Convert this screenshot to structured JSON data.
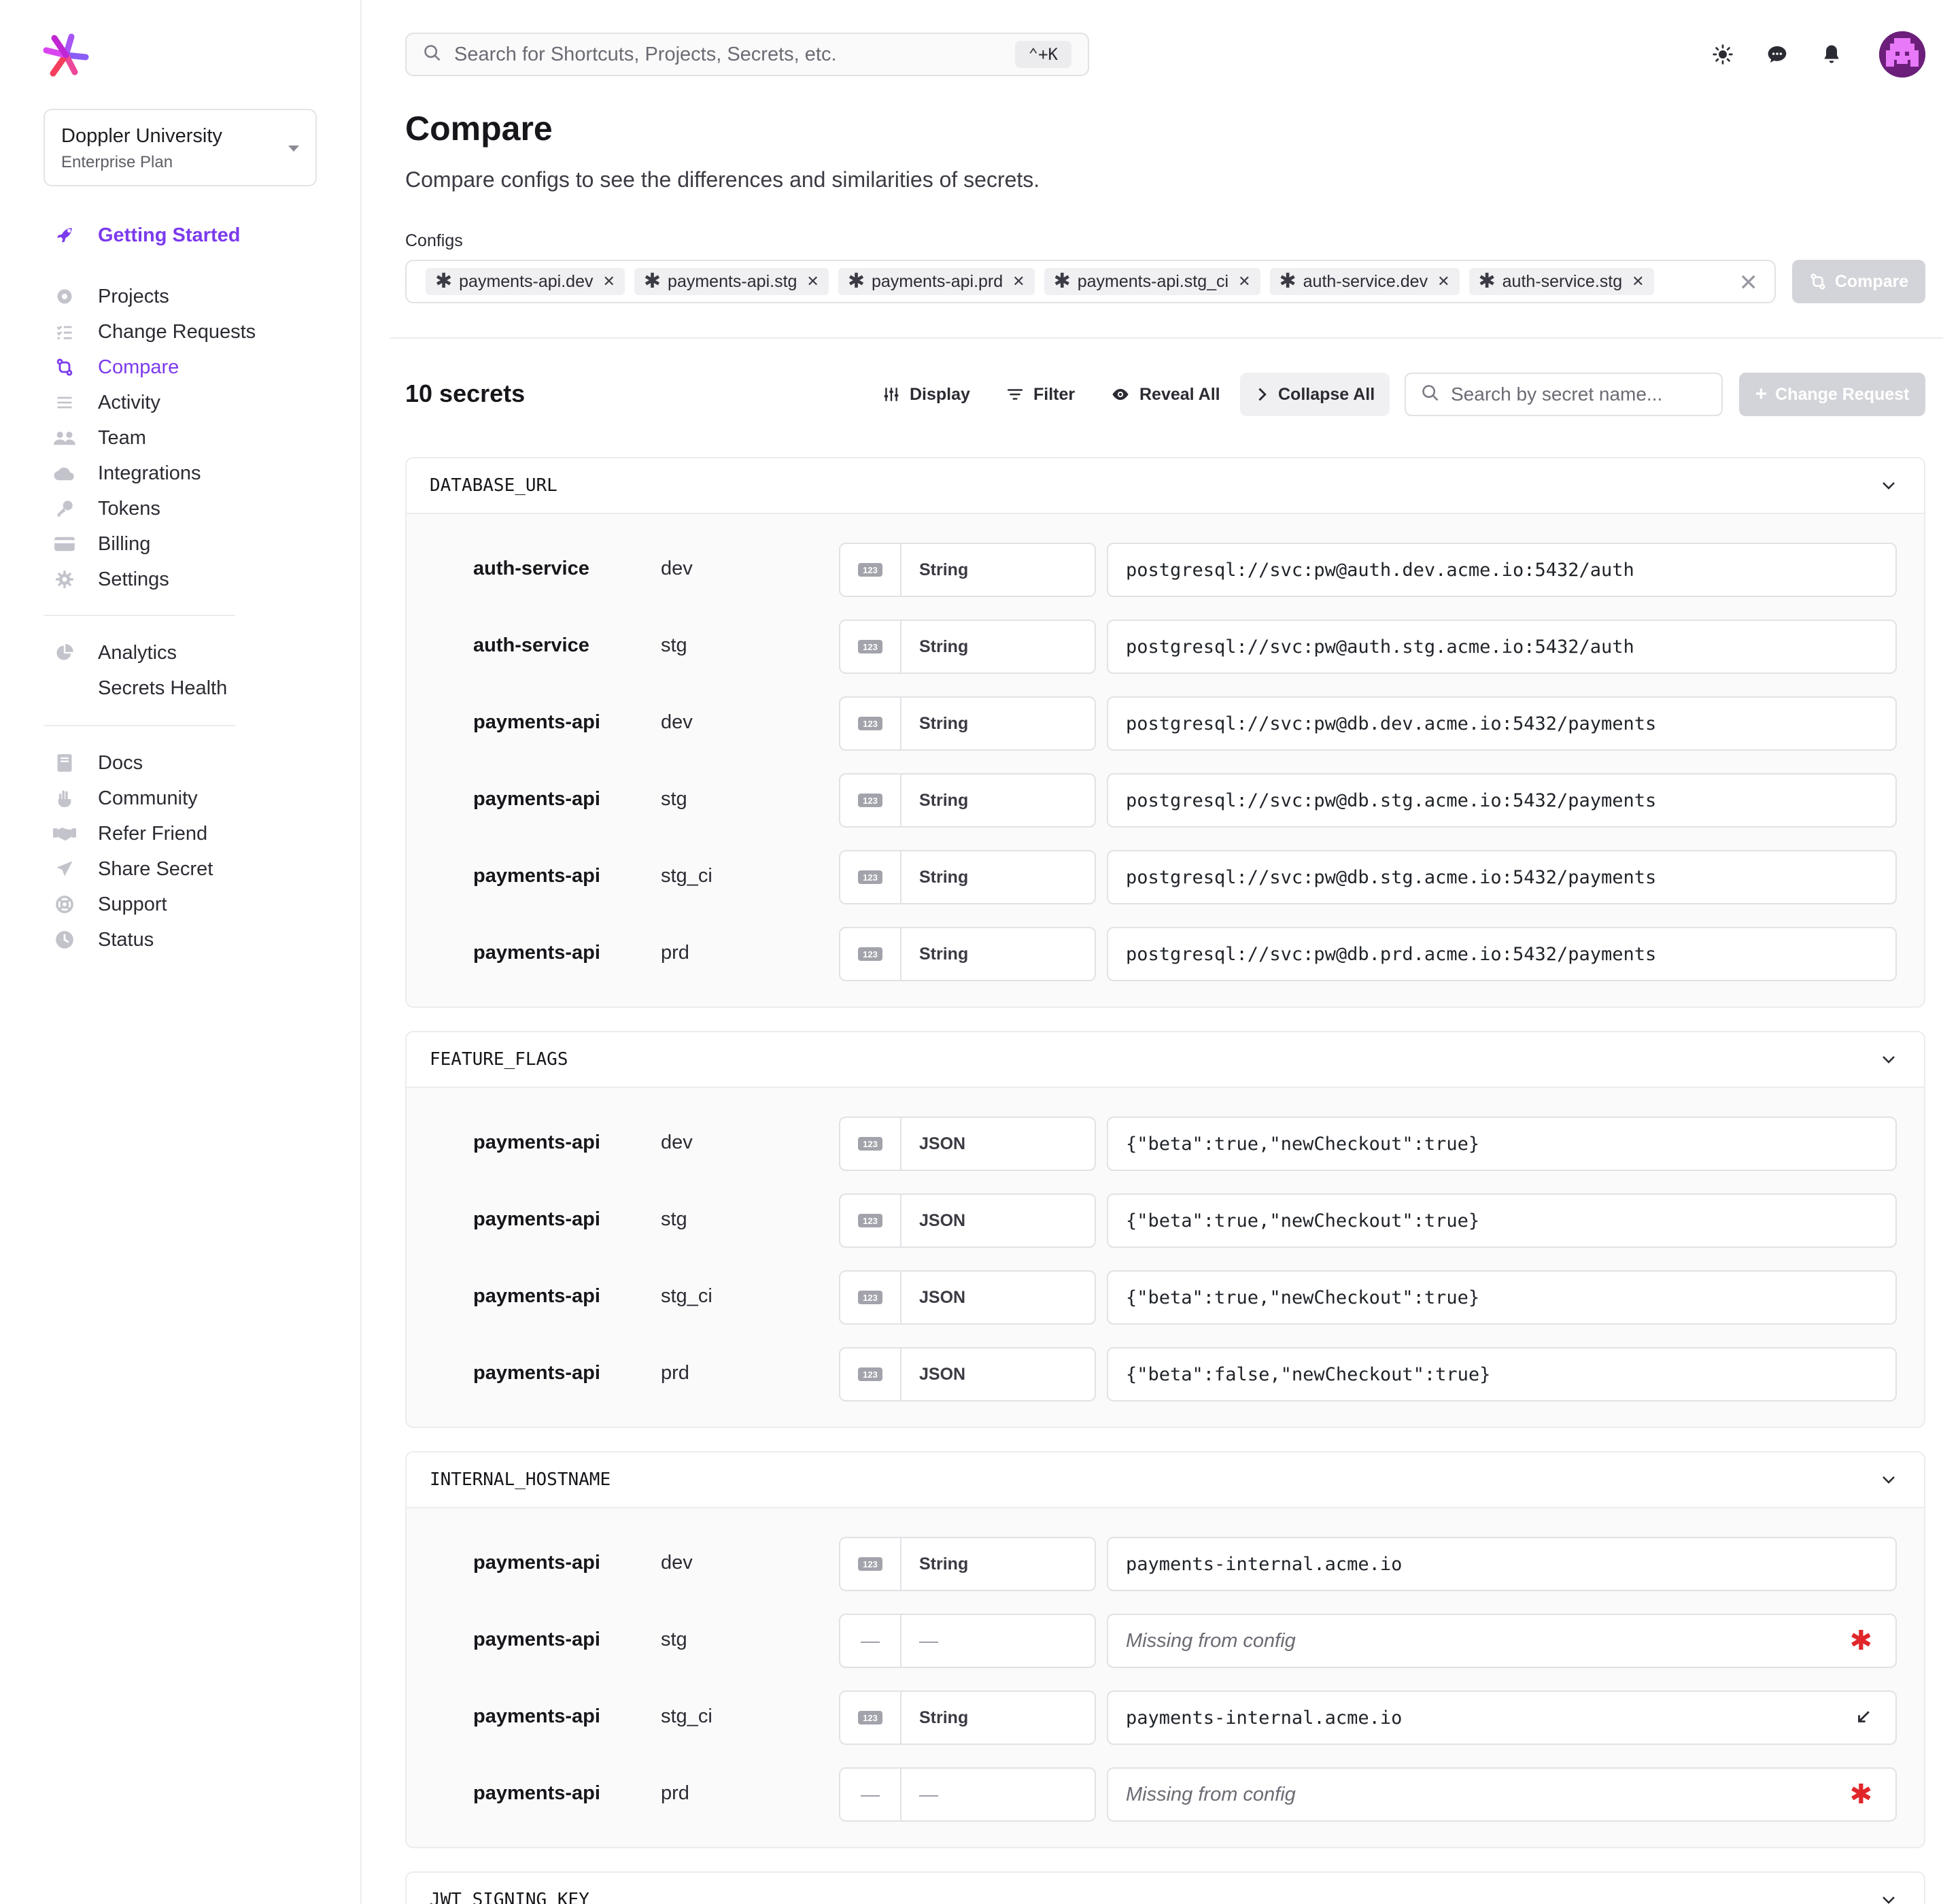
{
  "org": {
    "name": "Doppler University",
    "plan": "Enterprise Plan"
  },
  "nav": {
    "getting_started": "Getting Started",
    "main": [
      "Projects",
      "Change Requests",
      "Compare",
      "Activity",
      "Team",
      "Integrations",
      "Tokens",
      "Billing",
      "Settings"
    ],
    "analytics": "Analytics",
    "secrets_health": "Secrets Health",
    "footer": [
      "Docs",
      "Community",
      "Refer Friend",
      "Share Secret",
      "Support",
      "Status"
    ]
  },
  "search": {
    "placeholder": "Search for Shortcuts, Projects, Secrets, etc.",
    "shortcut": "⌃+K"
  },
  "page": {
    "title": "Compare",
    "description": "Compare configs to see the differences and similarities of secrets.",
    "configs_label": "Configs",
    "compare_label": "Compare"
  },
  "configs": [
    "payments-api.dev",
    "payments-api.stg",
    "payments-api.prd",
    "payments-api.stg_ci",
    "auth-service.dev",
    "auth-service.stg"
  ],
  "toolbar": {
    "count": "10 secrets",
    "display": "Display",
    "filter": "Filter",
    "reveal_all": "Reveal All",
    "collapse_all": "Collapse All",
    "search_placeholder": "Search by secret name...",
    "change_request": "Change Request"
  },
  "groups": [
    {
      "name": "DATABASE_URL",
      "rows": [
        {
          "project": "auth-service",
          "env": "dev",
          "type": "String",
          "value": "postgresql://svc:pw@auth.dev.acme.io:5432/auth"
        },
        {
          "project": "auth-service",
          "env": "stg",
          "type": "String",
          "value": "postgresql://svc:pw@auth.stg.acme.io:5432/auth"
        },
        {
          "project": "payments-api",
          "env": "dev",
          "type": "String",
          "value": "postgresql://svc:pw@db.dev.acme.io:5432/payments"
        },
        {
          "project": "payments-api",
          "env": "stg",
          "type": "String",
          "value": "postgresql://svc:pw@db.stg.acme.io:5432/payments"
        },
        {
          "project": "payments-api",
          "env": "stg_ci",
          "type": "String",
          "value": "postgresql://svc:pw@db.stg.acme.io:5432/payments"
        },
        {
          "project": "payments-api",
          "env": "prd",
          "type": "String",
          "value": "postgresql://svc:pw@db.prd.acme.io:5432/payments"
        }
      ]
    },
    {
      "name": "FEATURE_FLAGS",
      "rows": [
        {
          "project": "payments-api",
          "env": "dev",
          "type": "JSON",
          "value": "{\"beta\":true,\"newCheckout\":true}"
        },
        {
          "project": "payments-api",
          "env": "stg",
          "type": "JSON",
          "value": "{\"beta\":true,\"newCheckout\":true}"
        },
        {
          "project": "payments-api",
          "env": "stg_ci",
          "type": "JSON",
          "value": "{\"beta\":true,\"newCheckout\":true}"
        },
        {
          "project": "payments-api",
          "env": "prd",
          "type": "JSON",
          "value": "{\"beta\":false,\"newCheckout\":true}"
        }
      ]
    },
    {
      "name": "INTERNAL_HOSTNAME",
      "rows": [
        {
          "project": "payments-api",
          "env": "dev",
          "type": "String",
          "value": "payments-internal.acme.io"
        },
        {
          "project": "payments-api",
          "env": "stg",
          "type": "—",
          "type_icon": "—",
          "value": "Missing from config",
          "missing": true
        },
        {
          "project": "payments-api",
          "env": "stg_ci",
          "type": "String",
          "value": "payments-internal.acme.io",
          "inherited": true
        },
        {
          "project": "payments-api",
          "env": "prd",
          "type": "—",
          "type_icon": "—",
          "value": "Missing from config",
          "missing": true
        }
      ]
    },
    {
      "name": "JWT_SIGNING_KEY",
      "rows": []
    }
  ],
  "colors": {
    "accent": "#7c3aed",
    "missing_flag": "#e0262a",
    "disabled_button": "#d3d4d9"
  }
}
